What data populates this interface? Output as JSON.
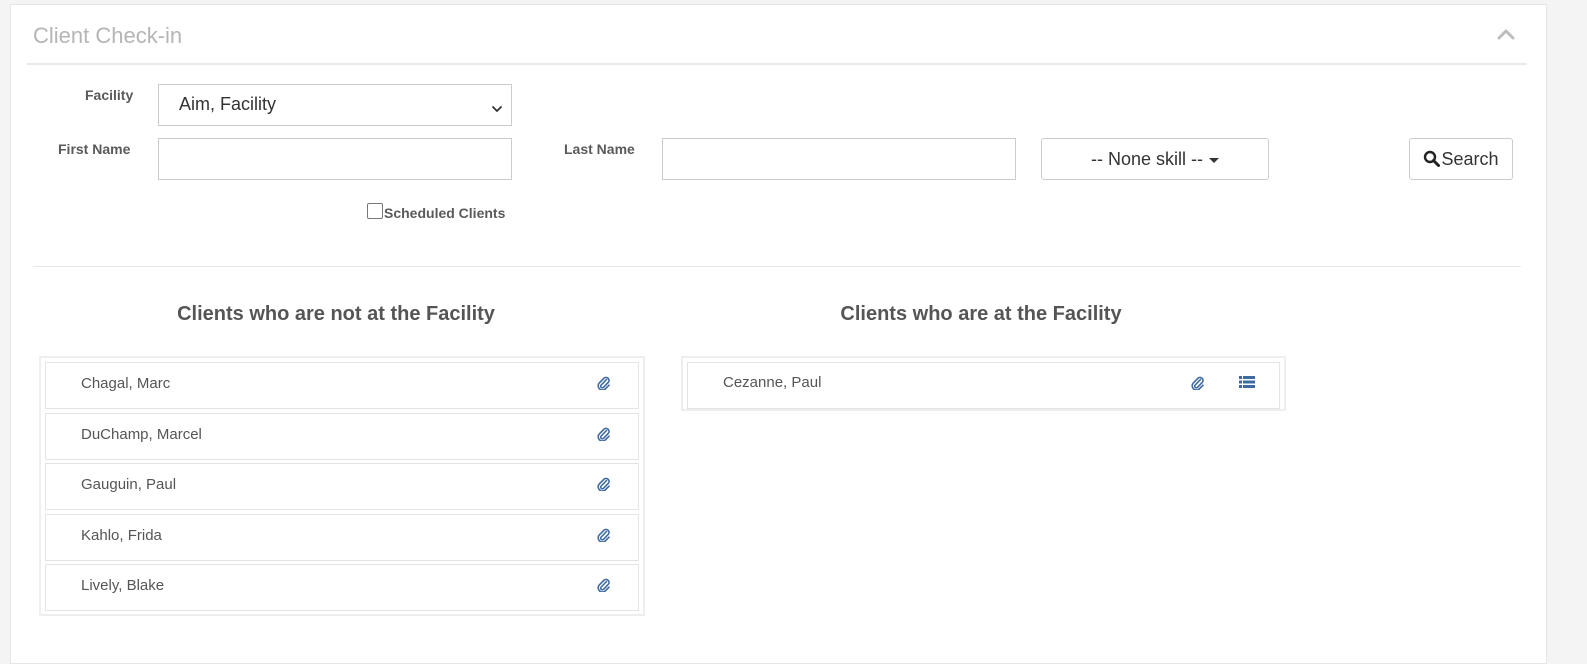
{
  "panel": {
    "title": "Client Check-in",
    "collapse_icon": "chevron-up-icon"
  },
  "form": {
    "facility_label": "Facility",
    "facility_value": "Aim, Facility",
    "first_name_label": "First Name",
    "first_name_value": "",
    "last_name_label": "Last Name",
    "last_name_value": "",
    "skill_label": "-- None skill --",
    "search_label": "Search",
    "scheduled_label": "Scheduled Clients",
    "scheduled_checked": false
  },
  "not_at_facility": {
    "title": "Clients who are not at the Facility",
    "clients": [
      {
        "name": "Chagal, Marc"
      },
      {
        "name": "DuChamp, Marcel"
      },
      {
        "name": "Gauguin, Paul"
      },
      {
        "name": "Kahlo, Frida"
      },
      {
        "name": "Lively, Blake"
      }
    ]
  },
  "at_facility": {
    "title": "Clients who are at the Facility",
    "clients": [
      {
        "name": "Cezanne, Paul"
      }
    ]
  },
  "colors": {
    "icon_blue": "#3f6aa1",
    "title_gray": "#b5b5b5"
  }
}
